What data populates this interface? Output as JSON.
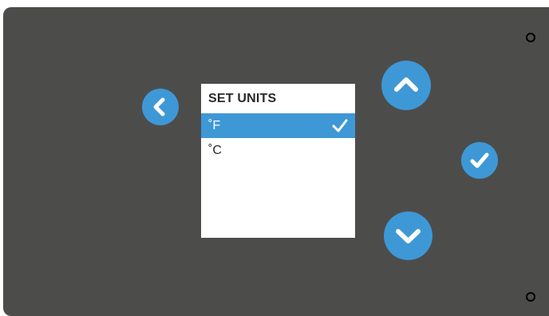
{
  "device": {
    "screen": {
      "title": "SET UNITS",
      "options": [
        {
          "label": "˚F",
          "selected": true
        },
        {
          "label": "˚C",
          "selected": false
        }
      ]
    },
    "buttons": {
      "back_icon": "chevron-left",
      "up_icon": "chevron-up",
      "down_icon": "chevron-down",
      "confirm_icon": "checkmark"
    },
    "colors": {
      "panel": "#4c4d4b",
      "accent": "#3e98d6",
      "screen": "#ffffff",
      "text": "#2a2a2a"
    }
  }
}
